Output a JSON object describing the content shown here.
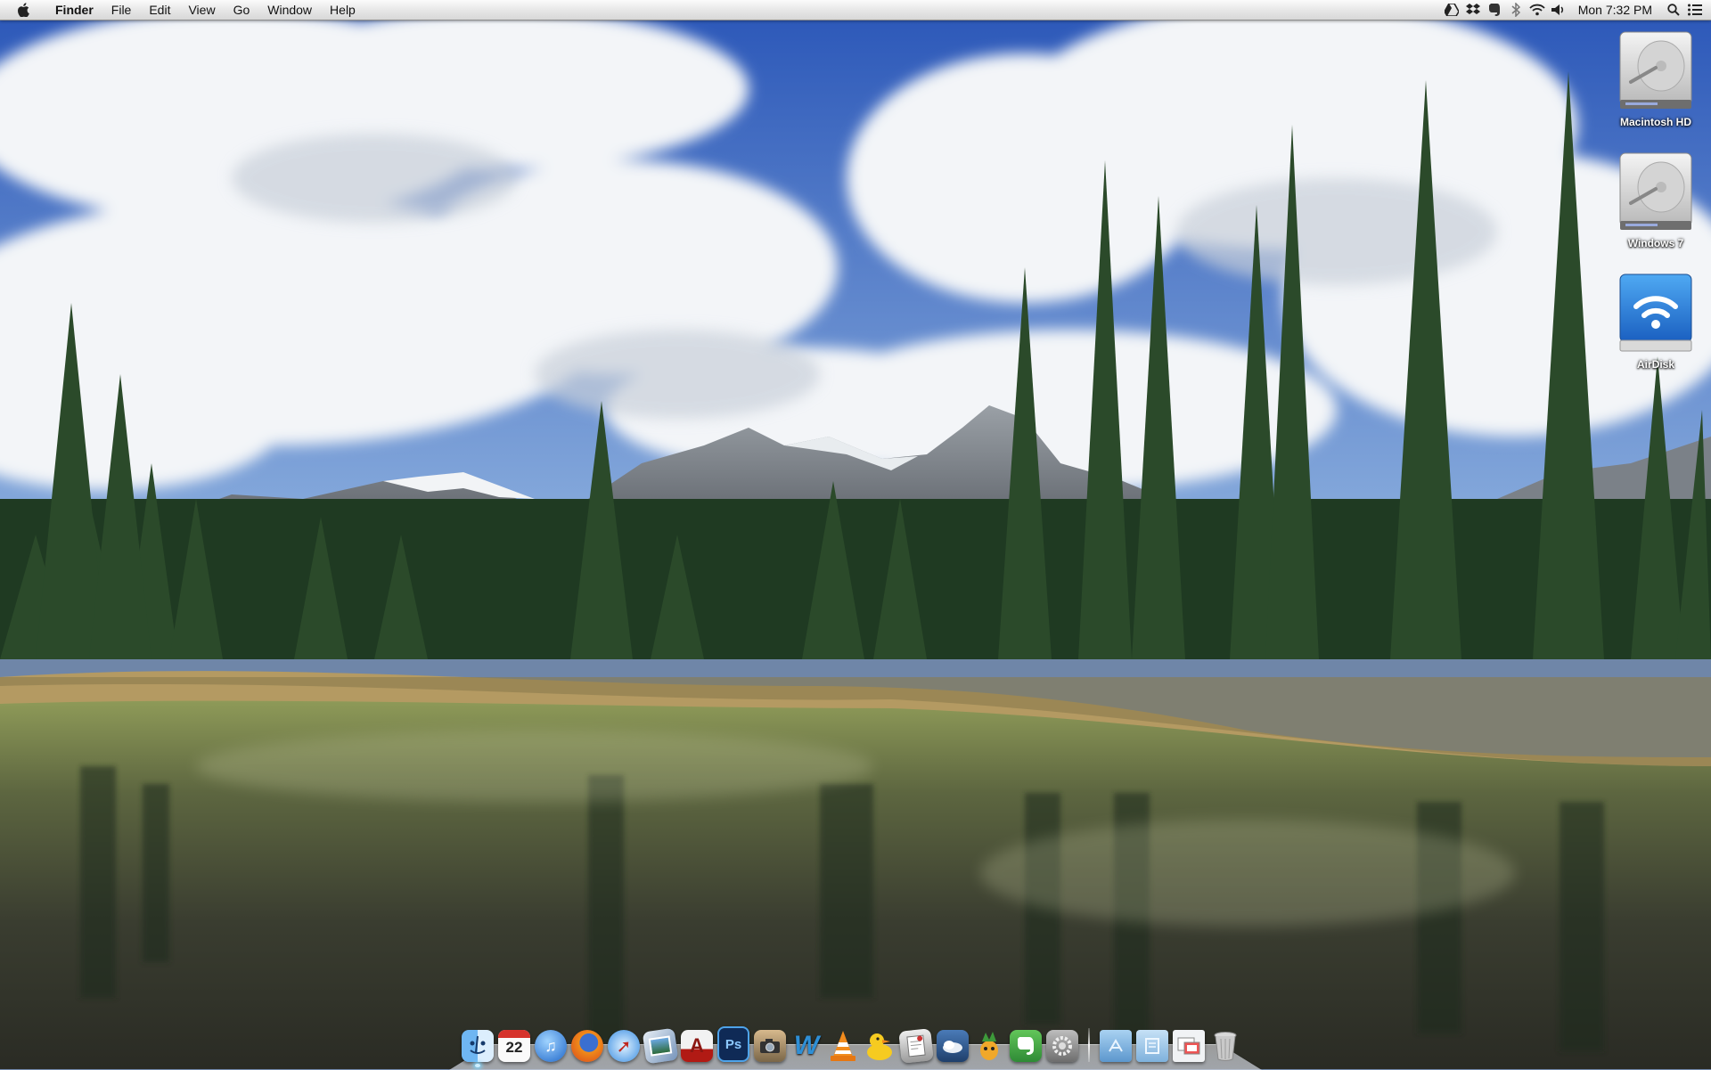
{
  "menubar": {
    "apple_icon": "apple-icon",
    "app_name": "Finder",
    "items": [
      "File",
      "Edit",
      "View",
      "Go",
      "Window",
      "Help"
    ],
    "status_icons": [
      "google-drive-icon",
      "dropbox-icon",
      "evernote-icon",
      "bluetooth-icon",
      "wifi-icon",
      "volume-icon"
    ],
    "clock": "Mon 7:32 PM",
    "spotlight_icon": "spotlight-search-icon",
    "notification_icon": "notification-center-icon"
  },
  "desktop": {
    "icons": [
      {
        "label": "Macintosh HD",
        "icon": "hard-drive-icon"
      },
      {
        "label": "Windows 7",
        "icon": "hard-drive-icon"
      },
      {
        "label": "AirDisk",
        "icon": "airdisk-wifi-icon"
      }
    ]
  },
  "dock": {
    "calendar_day": "22",
    "apps": [
      {
        "name": "Finder",
        "icon": "finder-icon",
        "color": "#4a8de0"
      },
      {
        "name": "Calendar",
        "icon": "calendar-icon",
        "color": "#f4f4f4"
      },
      {
        "name": "iTunes",
        "icon": "itunes-icon",
        "color": "#2f7fd8"
      },
      {
        "name": "Firefox",
        "icon": "firefox-icon",
        "color": "#e8731c"
      },
      {
        "name": "Safari",
        "icon": "safari-icon",
        "color": "#3c8fe4"
      },
      {
        "name": "iPhoto",
        "icon": "iphoto-icon",
        "color": "#6f8fb4"
      },
      {
        "name": "Acrobat",
        "icon": "acrobat-icon",
        "color": "#b11a14"
      },
      {
        "name": "Photoshop",
        "icon": "photoshop-icon",
        "color": "#0f2a56"
      },
      {
        "name": "Image Capture",
        "icon": "image-capture-icon",
        "color": "#8a7a60"
      },
      {
        "name": "Word",
        "icon": "word-icon",
        "color": "#2e8fd6"
      },
      {
        "name": "VLC",
        "icon": "vlc-icon",
        "color": "#f08a1c"
      },
      {
        "name": "Cyberduck",
        "icon": "cyberduck-icon",
        "color": "#f4c71e"
      },
      {
        "name": "Script Editor",
        "icon": "script-editor-icon",
        "color": "#9a9a9a"
      },
      {
        "name": "Weather",
        "icon": "weather-icon",
        "color": "#2d5d92"
      },
      {
        "name": "Adium",
        "icon": "adium-icon",
        "color": "#7fb140"
      },
      {
        "name": "Evernote",
        "icon": "evernote-app-icon",
        "color": "#3fa34a"
      },
      {
        "name": "System Preferences",
        "icon": "system-preferences-icon",
        "color": "#8d8d8d"
      }
    ],
    "stacks": [
      {
        "name": "Applications",
        "icon": "applications-folder-icon",
        "color": "#6fa8d8"
      },
      {
        "name": "Documents",
        "icon": "documents-folder-icon",
        "color": "#8cbbe2"
      },
      {
        "name": "Preview",
        "icon": "preview-icon",
        "color": "#e9eef2"
      },
      {
        "name": "Trash",
        "icon": "trash-icon",
        "color": "#c6c6c6"
      }
    ],
    "running": [
      "Finder"
    ]
  }
}
